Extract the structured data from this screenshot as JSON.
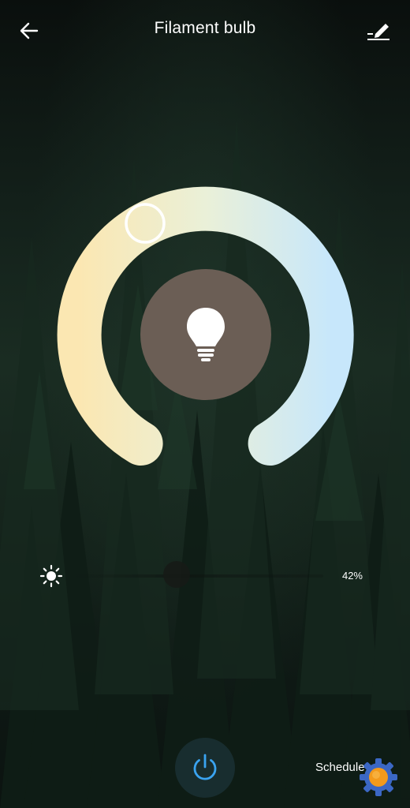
{
  "header": {
    "title": "Filament bulb",
    "back_icon": "arrow-left-icon",
    "edit_icon": "pencil-edit-icon"
  },
  "color_temperature": {
    "warm_color": "#fbe7b2",
    "cool_color": "#c7e7fb",
    "thumb_position_fraction": 0.18
  },
  "bulb": {
    "icon": "lightbulb-icon",
    "background_color": "#6b5e55"
  },
  "brightness": {
    "icon": "sun-icon",
    "value_label": "42%",
    "value_fraction": 0.42
  },
  "footer": {
    "power_icon": "power-icon",
    "power_color": "#3aa3f0",
    "schedule_label": "Schedule",
    "gear_icon": "gear-badge-icon"
  }
}
